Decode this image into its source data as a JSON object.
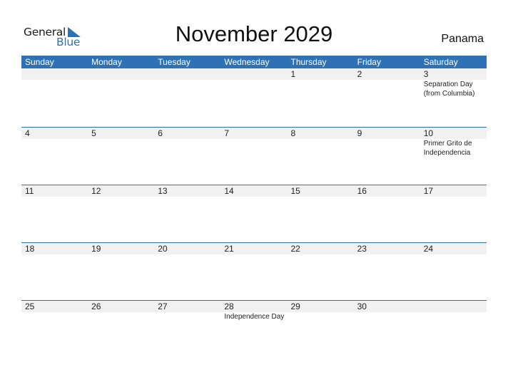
{
  "brand": {
    "general": "General",
    "blue": "Blue",
    "accent_color": "#2e71b4"
  },
  "title": "November 2029",
  "country": "Panama",
  "weekdays": [
    "Sunday",
    "Monday",
    "Tuesday",
    "Wednesday",
    "Thursday",
    "Friday",
    "Saturday"
  ],
  "weeks": [
    {
      "days": [
        {
          "num": "",
          "event": ""
        },
        {
          "num": "",
          "event": ""
        },
        {
          "num": "",
          "event": ""
        },
        {
          "num": "",
          "event": ""
        },
        {
          "num": "1",
          "event": ""
        },
        {
          "num": "2",
          "event": ""
        },
        {
          "num": "3",
          "event": "Separation Day (from Columbia)"
        }
      ]
    },
    {
      "days": [
        {
          "num": "4",
          "event": ""
        },
        {
          "num": "5",
          "event": ""
        },
        {
          "num": "6",
          "event": ""
        },
        {
          "num": "7",
          "event": ""
        },
        {
          "num": "8",
          "event": ""
        },
        {
          "num": "9",
          "event": ""
        },
        {
          "num": "10",
          "event": "Primer Grito de Independencia"
        }
      ]
    },
    {
      "days": [
        {
          "num": "11",
          "event": ""
        },
        {
          "num": "12",
          "event": ""
        },
        {
          "num": "13",
          "event": ""
        },
        {
          "num": "14",
          "event": ""
        },
        {
          "num": "15",
          "event": ""
        },
        {
          "num": "16",
          "event": ""
        },
        {
          "num": "17",
          "event": ""
        }
      ]
    },
    {
      "days": [
        {
          "num": "18",
          "event": ""
        },
        {
          "num": "19",
          "event": ""
        },
        {
          "num": "20",
          "event": ""
        },
        {
          "num": "21",
          "event": ""
        },
        {
          "num": "22",
          "event": ""
        },
        {
          "num": "23",
          "event": ""
        },
        {
          "num": "24",
          "event": ""
        }
      ]
    },
    {
      "days": [
        {
          "num": "25",
          "event": ""
        },
        {
          "num": "26",
          "event": ""
        },
        {
          "num": "27",
          "event": ""
        },
        {
          "num": "28",
          "event": "Independence Day"
        },
        {
          "num": "29",
          "event": ""
        },
        {
          "num": "30",
          "event": ""
        },
        {
          "num": "",
          "event": ""
        }
      ]
    }
  ]
}
